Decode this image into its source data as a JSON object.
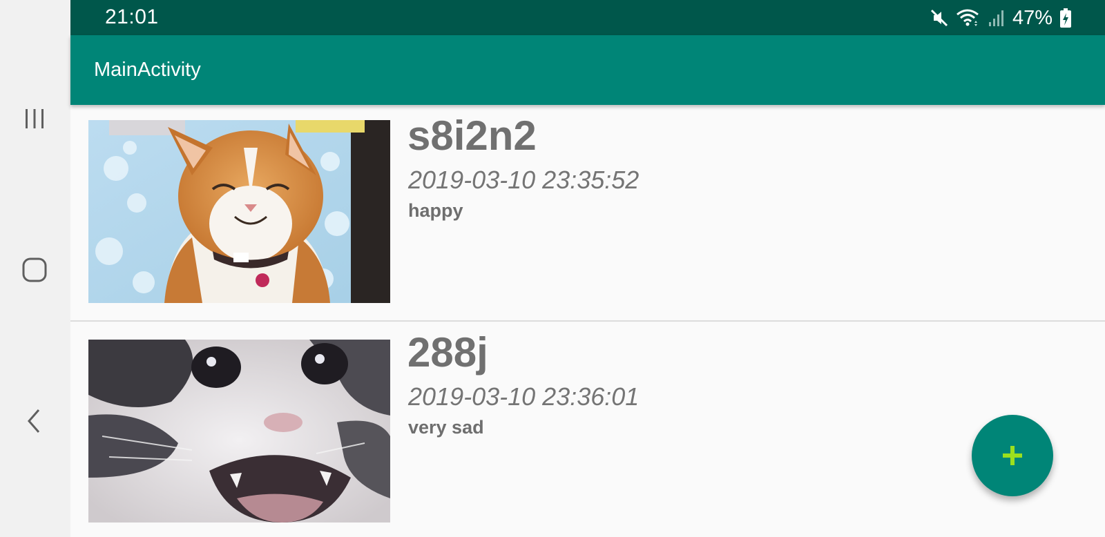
{
  "status_bar": {
    "time": "21:01",
    "battery": "47%",
    "icons": [
      "mute-icon",
      "wifi-icon",
      "signal-icon",
      "battery-charging-icon"
    ]
  },
  "toolbar": {
    "title": "MainActivity"
  },
  "colors": {
    "status_bar": "#00574b",
    "primary": "#008577",
    "fab_icon": "#9be01e"
  },
  "items": [
    {
      "title": "s8i2n2",
      "date": "2019-03-10 23:35:52",
      "description": "happy",
      "image": "happy-cat-photo"
    },
    {
      "title": "288j",
      "date": "2019-03-10 23:36:01",
      "description": "very sad",
      "image": "crying-cat-photo"
    }
  ],
  "fab": {
    "icon": "plus-icon"
  },
  "navigation": {
    "buttons": [
      "recents-icon",
      "home-icon",
      "back-icon"
    ]
  }
}
